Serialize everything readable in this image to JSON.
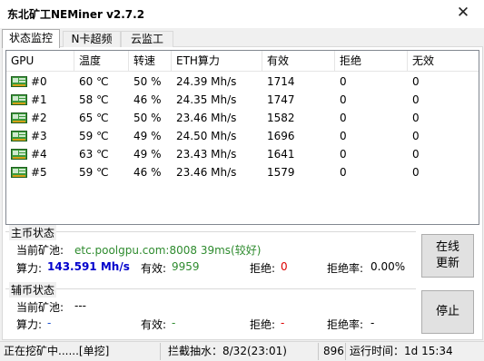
{
  "window": {
    "title": "东北矿工NEMiner v2.7.2",
    "close_glyph": "✕"
  },
  "tabs": [
    {
      "label": "状态监控",
      "active": true
    },
    {
      "label": "N卡超频",
      "active": false
    },
    {
      "label": "云监工",
      "active": false
    }
  ],
  "gpu_table": {
    "columns": [
      "GPU",
      "温度",
      "转速",
      "ETH算力",
      "有效",
      "拒绝",
      "无效"
    ],
    "rows": [
      {
        "id": "#0",
        "temp": "60 ℃",
        "fan": "50 %",
        "hashrate": "24.39 Mh/s",
        "valid": "1714",
        "rejected": "0",
        "invalid": "0"
      },
      {
        "id": "#1",
        "temp": "58 ℃",
        "fan": "46 %",
        "hashrate": "24.35 Mh/s",
        "valid": "1747",
        "rejected": "0",
        "invalid": "0"
      },
      {
        "id": "#2",
        "temp": "65 ℃",
        "fan": "50 %",
        "hashrate": "23.46 Mh/s",
        "valid": "1582",
        "rejected": "0",
        "invalid": "0"
      },
      {
        "id": "#3",
        "temp": "59 ℃",
        "fan": "49 %",
        "hashrate": "24.50 Mh/s",
        "valid": "1696",
        "rejected": "0",
        "invalid": "0"
      },
      {
        "id": "#4",
        "temp": "63 ℃",
        "fan": "49 %",
        "hashrate": "23.43 Mh/s",
        "valid": "1641",
        "rejected": "0",
        "invalid": "0"
      },
      {
        "id": "#5",
        "temp": "59 ℃",
        "fan": "46 %",
        "hashrate": "23.46 Mh/s",
        "valid": "1579",
        "rejected": "0",
        "invalid": "0"
      }
    ]
  },
  "main_coin": {
    "section_title": "主币状态",
    "pool_label": "当前矿池:",
    "pool_value": "etc.poolgpu.com:8008 39ms(较好)",
    "hashrate_label": "算力:",
    "hashrate_value": "143.591 Mh/s",
    "valid_label": "有效:",
    "valid_value": "9959",
    "rejected_label": "拒绝:",
    "rejected_value": "0",
    "reject_rate_label": "拒绝率:",
    "reject_rate_value": "0.00%"
  },
  "aux_coin": {
    "section_title": "辅币状态",
    "pool_label": "当前矿池:",
    "pool_value": "---",
    "hashrate_label": "算力:",
    "hashrate_value": "-",
    "valid_label": "有效:",
    "valid_value": "-",
    "rejected_label": "拒绝:",
    "rejected_value": "-",
    "reject_rate_label": "拒绝率:",
    "reject_rate_value": "-"
  },
  "buttons": {
    "online_update_line1": "在线",
    "online_update_line2": "更新",
    "stop": "停止"
  },
  "statusbar": {
    "mining_status": "正在挖矿中......[单挖]",
    "dev_fee": "拦截抽水：8/32(23:01)",
    "count": "896",
    "runtime": "运行时间：1d 15:34"
  },
  "colors": {
    "pool_green": "#2e8b2e",
    "hashrate_blue": "#0000cc",
    "valid_green": "#2e8b2e",
    "rejected_red": "#dd0000",
    "aux_dash_blue": "#1a4fd0",
    "aux_dash_green": "#2e8b2e",
    "aux_dash_red": "#dd0000"
  }
}
